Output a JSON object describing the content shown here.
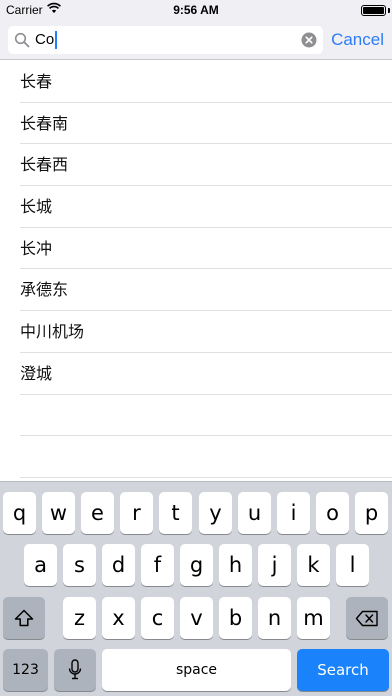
{
  "status_bar": {
    "carrier": "Carrier",
    "time": "9:56 AM"
  },
  "search": {
    "query": "Co",
    "cancel_label": "Cancel"
  },
  "results": [
    "长春",
    "长春南",
    "长春西",
    "长城",
    "长冲",
    "承德东",
    "中川机场",
    "澄城",
    "",
    ""
  ],
  "keyboard": {
    "row1": [
      "q",
      "w",
      "e",
      "r",
      "t",
      "y",
      "u",
      "i",
      "o",
      "p"
    ],
    "row2": [
      "a",
      "s",
      "d",
      "f",
      "g",
      "h",
      "j",
      "k",
      "l"
    ],
    "row3": [
      "z",
      "x",
      "c",
      "v",
      "b",
      "n",
      "m"
    ],
    "numbers_label": "123",
    "space_label": "space",
    "search_label": "Search"
  },
  "colors": {
    "accent": "#2e7cf6",
    "search_key": "#1a82fb",
    "keyboard_bg": "#d1d5db"
  },
  "icons": [
    "wifi-icon",
    "battery-icon",
    "search-icon",
    "clear-icon",
    "shift-icon",
    "delete-icon",
    "microphone-icon"
  ]
}
